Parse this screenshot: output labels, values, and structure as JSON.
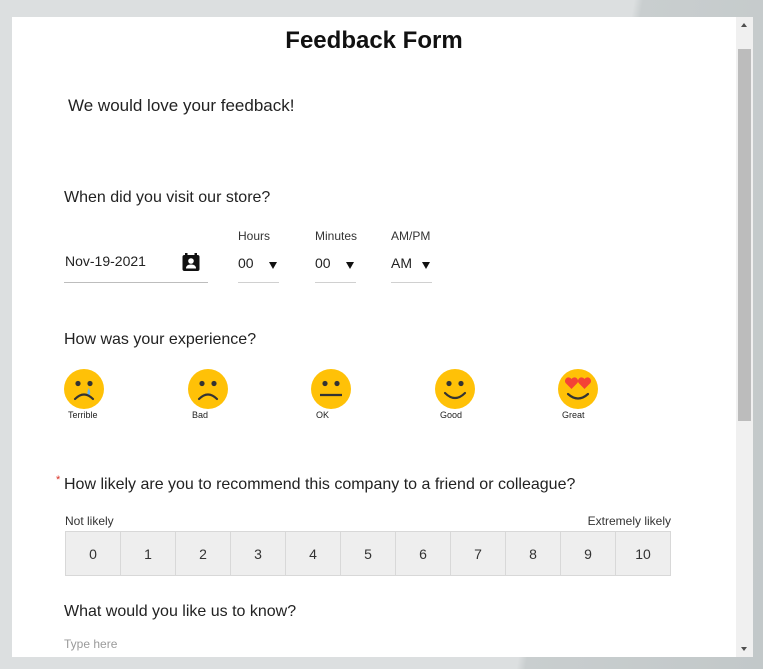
{
  "form": {
    "title": "Feedback Form",
    "intro": "We would love your feedback!"
  },
  "visit": {
    "question": "When did you visit our store?",
    "date_value": "Nov-19-2021",
    "date_icon": "calendar-icon",
    "hours": {
      "label": "Hours",
      "value": "00"
    },
    "minutes": {
      "label": "Minutes",
      "value": "00"
    },
    "ampm": {
      "label": "AM/PM",
      "value": "AM"
    }
  },
  "experience": {
    "question": "How was your experience?",
    "options": [
      {
        "label": "Terrible",
        "icon": "crying-face-icon"
      },
      {
        "label": "Bad",
        "icon": "frowning-face-icon"
      },
      {
        "label": "OK",
        "icon": "neutral-face-icon"
      },
      {
        "label": "Good",
        "icon": "smiling-face-icon"
      },
      {
        "label": "Great",
        "icon": "heart-eyes-face-icon"
      }
    ]
  },
  "recommend": {
    "required_mark": "*",
    "question": "How likely are you to recommend this company to a friend or colleague?",
    "low_label": "Not likely",
    "high_label": "Extremely likely",
    "scale": [
      "0",
      "1",
      "2",
      "3",
      "4",
      "5",
      "6",
      "7",
      "8",
      "9",
      "10"
    ]
  },
  "comments": {
    "question": "What would you like us to know?",
    "placeholder": "Type here",
    "value": ""
  },
  "colors": {
    "emoji_yellow": "#ffc107",
    "emoji_features": "#333333",
    "tear": "#64b5f6",
    "heart": "#f44336",
    "required": "#d93025"
  }
}
